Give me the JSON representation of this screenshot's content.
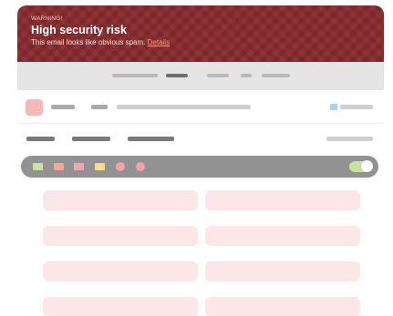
{
  "banner": {
    "kicker": "WARNING!",
    "title": "High security risk",
    "message": "This email looks like obvious spam.",
    "details_link": "Details"
  },
  "colors": {
    "banner_bg": "#8a2b2e",
    "link": "#ff9a8f",
    "toolbar_bg": "#e5e5e5",
    "pill_bar_bg": "#929292",
    "avatar": "#f4baba",
    "grid_cell": "#fbe7e7",
    "toggle_on": "#c6e3a3",
    "chip_green": "#c6e3a3",
    "chip_salmon": "#f5a79a",
    "chip_pink": "#f4a6b0",
    "chip_yellow": "#f6dc8e",
    "circle_pink": "#f2a3a5"
  },
  "toolbar": {
    "active_index": 1,
    "item_count": 5
  },
  "pill_bar": {
    "chip_colors": [
      "#c6e3a3",
      "#f5a79a",
      "#f4a6b0",
      "#f6dc8e"
    ],
    "circle_count": 2,
    "toggle_on": true
  },
  "grid": {
    "rows": 4,
    "columns": 2
  }
}
